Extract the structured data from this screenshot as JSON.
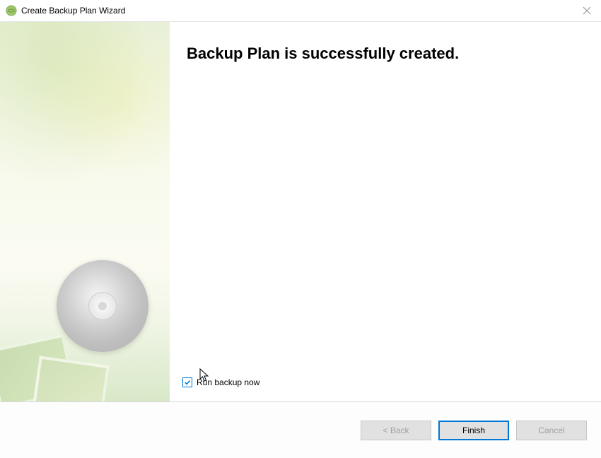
{
  "titlebar": {
    "title": "Create Backup Plan Wizard"
  },
  "content": {
    "heading": "Backup Plan is successfully created.",
    "checkbox_label": "Run backup now",
    "checkbox_checked": true
  },
  "buttons": {
    "back": "< Back",
    "finish": "Finish",
    "cancel": "Cancel"
  }
}
